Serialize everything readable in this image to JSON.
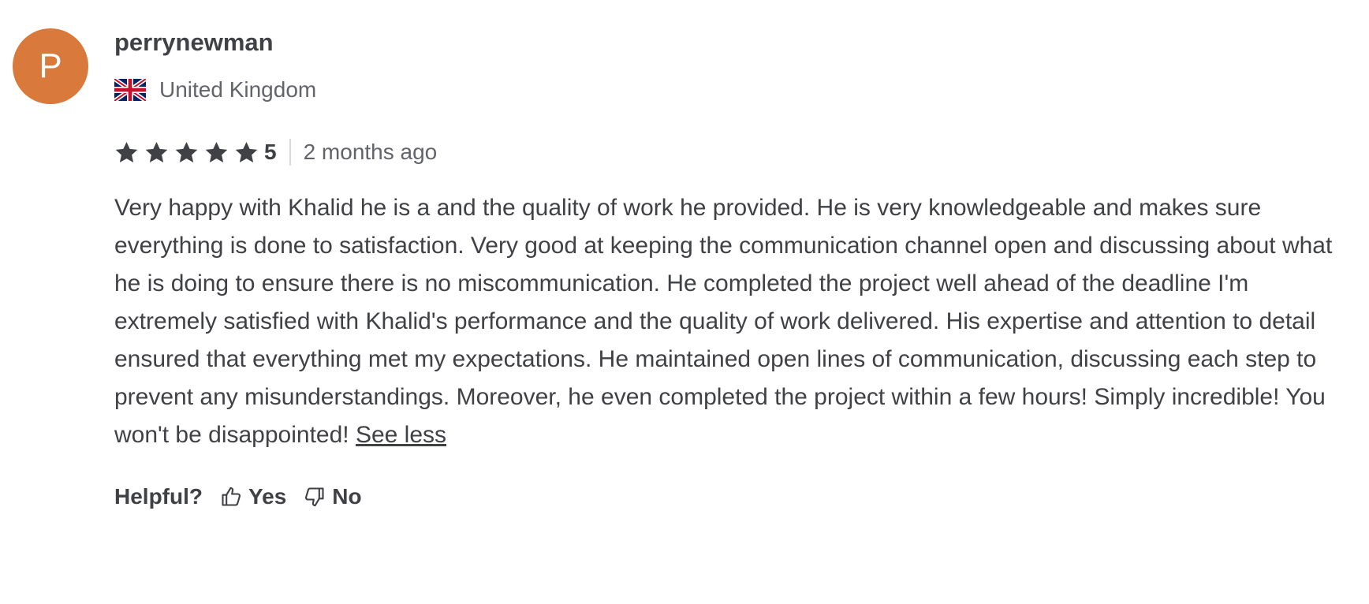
{
  "review": {
    "avatar_letter": "P",
    "avatar_color": "#d9793b",
    "username": "perrynewman",
    "country": {
      "flag_icon": "uk-flag-icon",
      "name": "United Kingdom"
    },
    "rating": {
      "stars": 5,
      "value": "5",
      "star_color": "#404145"
    },
    "time_ago": "2 months ago",
    "body": "Very happy with Khalid he is a and the quality of work he provided. He is very knowledgeable and makes sure everything is done to satisfaction. Very good at keeping the communication channel open and discussing about what he is doing to ensure there is no miscommunication. He completed the project well ahead of the deadline I'm extremely satisfied with Khalid's performance and the quality of work delivered. His expertise and attention to detail ensured that everything met my expectations. He maintained open lines of communication, discussing each step to prevent any misunderstandings. Moreover, he even completed the project within a few hours! Simply incredible! You won't be disappointed!",
    "see_less_label": "See less",
    "helpful": {
      "label": "Helpful?",
      "yes_label": "Yes",
      "yes_icon": "thumbs-up-icon",
      "no_label": "No",
      "no_icon": "thumbs-down-icon"
    }
  }
}
